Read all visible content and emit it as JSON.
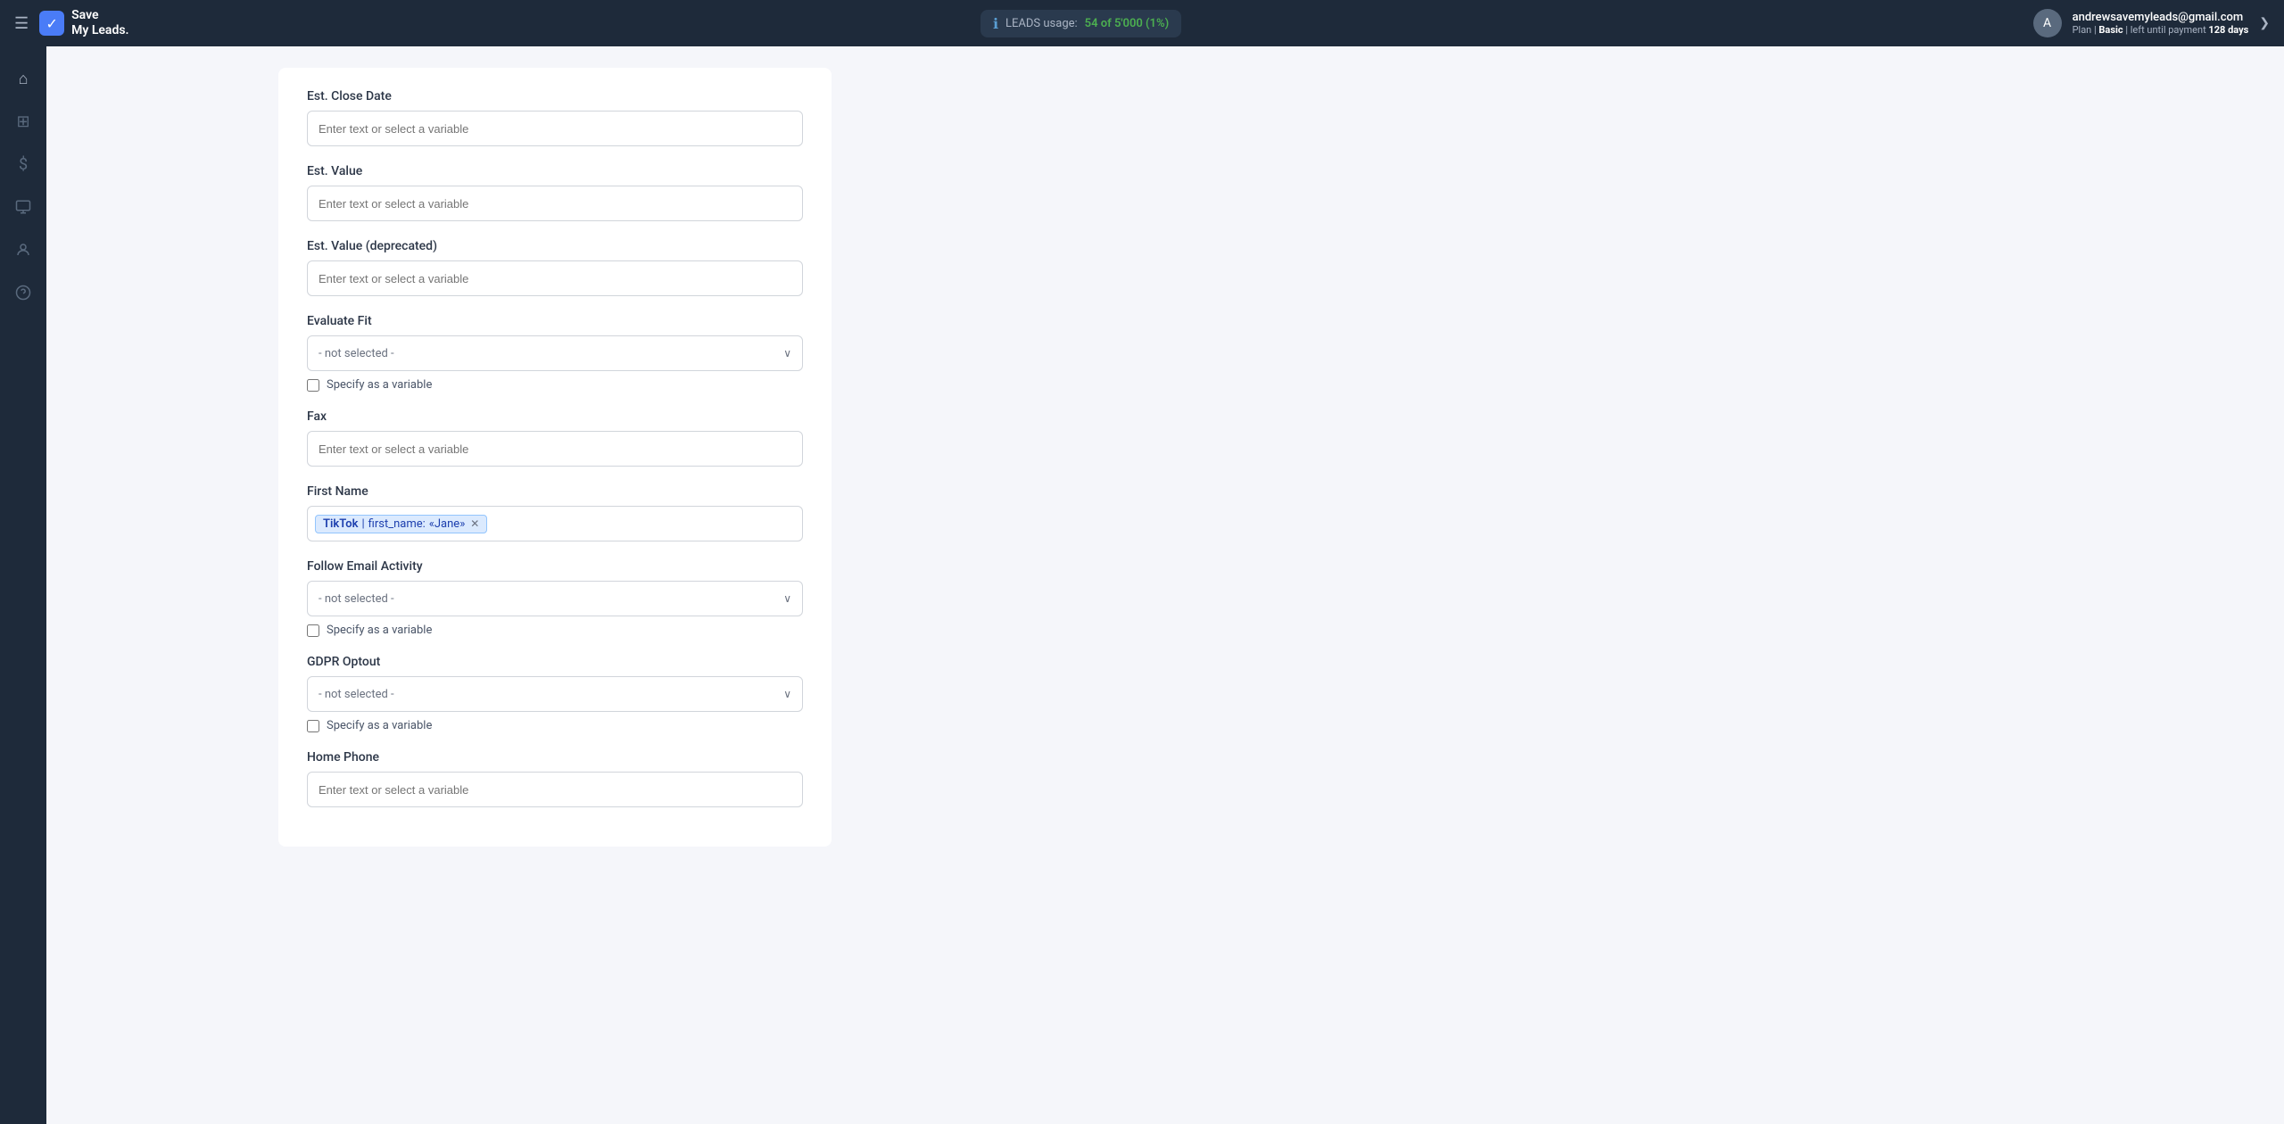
{
  "navbar": {
    "hamburger_label": "☰",
    "brand_line1": "Save",
    "brand_line2": "My Leads.",
    "brand_check_icon": "✓",
    "leads_usage_label": "LEADS usage:",
    "leads_usage_count": "54 of 5'000 (1%)",
    "user_email": "andrewsavemyleads@gmail.com",
    "plan_label": "Plan |",
    "plan_name": "Basic",
    "plan_suffix": "| left until payment",
    "plan_days": "128 days",
    "chevron_icon": "❯"
  },
  "sidebar": {
    "items": [
      {
        "icon": "⌂",
        "name": "home-icon"
      },
      {
        "icon": "⊞",
        "name": "connections-icon"
      },
      {
        "icon": "$",
        "name": "billing-icon"
      },
      {
        "icon": "⊡",
        "name": "integrations-icon"
      },
      {
        "icon": "◯",
        "name": "account-icon"
      },
      {
        "icon": "?",
        "name": "help-icon"
      }
    ]
  },
  "form": {
    "fields": [
      {
        "id": "est-close-date",
        "label": "Est. Close Date",
        "type": "text",
        "placeholder": "Enter text or select a variable"
      },
      {
        "id": "est-value",
        "label": "Est. Value",
        "type": "text",
        "placeholder": "Enter text or select a variable"
      },
      {
        "id": "est-value-deprecated",
        "label": "Est. Value (deprecated)",
        "type": "text",
        "placeholder": "Enter text or select a variable"
      },
      {
        "id": "evaluate-fit",
        "label": "Evaluate Fit",
        "type": "select",
        "placeholder": "- not selected -",
        "has_checkbox": true,
        "checkbox_label": "Specify as a variable"
      },
      {
        "id": "fax",
        "label": "Fax",
        "type": "text",
        "placeholder": "Enter text or select a variable"
      },
      {
        "id": "first-name",
        "label": "First Name",
        "type": "tag",
        "tag_source": "TikTok",
        "tag_field": "first_name:",
        "tag_value": "«Jane»"
      },
      {
        "id": "follow-email-activity",
        "label": "Follow Email Activity",
        "type": "select",
        "placeholder": "- not selected -",
        "has_checkbox": true,
        "checkbox_label": "Specify as a variable"
      },
      {
        "id": "gdpr-optout",
        "label": "GDPR Optout",
        "type": "select",
        "placeholder": "- not selected -",
        "has_checkbox": true,
        "checkbox_label": "Specify as a variable"
      },
      {
        "id": "home-phone",
        "label": "Home Phone",
        "type": "text",
        "placeholder": "Enter text or select a variable"
      }
    ],
    "not_selected_label": "- not selected -",
    "specify_variable_label": "Specify as a variable",
    "chevron_icon": "∨"
  }
}
